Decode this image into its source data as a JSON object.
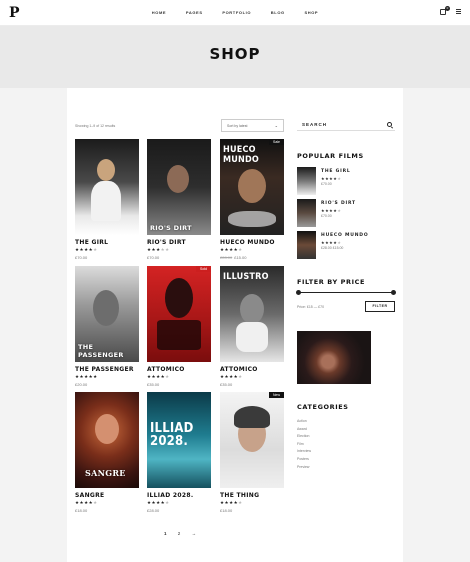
{
  "header": {
    "logo": "P",
    "nav": [
      "HOME",
      "PAGES",
      "PORTFOLIO",
      "BLOG",
      "SHOP"
    ],
    "cart_count": "0"
  },
  "hero": {
    "title": "SHOP"
  },
  "shop": {
    "result_count": "Showing 1–9 of 12 results",
    "sort_label": "Sort by latest",
    "products": [
      {
        "name": "THE GIRL",
        "poster_text": "",
        "poster_top": "",
        "rating": 4,
        "price": "£70.00",
        "old_price": "",
        "tag": ""
      },
      {
        "name": "RIO'S DIRT",
        "poster_text": "RIO'S DIRT",
        "poster_top": "",
        "rating": 4,
        "price": "£70.00",
        "old_price": "",
        "tag": ""
      },
      {
        "name": "HUECO MUNDO",
        "poster_text": "",
        "poster_top": "HUECO MUNDO",
        "rating": 4,
        "price": "£15.00",
        "old_price": "£28.00",
        "tag": "Sale"
      },
      {
        "name": "THE PASSENGER",
        "poster_text": "THE PASSENGER",
        "poster_top": "",
        "rating": 5,
        "price": "£20.00",
        "old_price": "",
        "tag": ""
      },
      {
        "name": "ATTOMICO",
        "poster_text": "",
        "poster_top": "",
        "rating": 4,
        "price": "£35.00",
        "old_price": "",
        "tag": "Sold"
      },
      {
        "name": "ATTOMICO",
        "poster_text": "",
        "poster_top": "ILLUSTRO",
        "rating": 4,
        "price": "£35.00",
        "old_price": "",
        "tag": ""
      },
      {
        "name": "SANGRE",
        "poster_text": "SANGRE",
        "poster_top": "",
        "rating": 4,
        "price": "£18.00",
        "old_price": "",
        "tag": ""
      },
      {
        "name": "ILLIAD 2028.",
        "poster_text": "",
        "poster_top": "ILLIAD 2028.",
        "rating": 4,
        "price": "£28.00",
        "old_price": "",
        "tag": ""
      },
      {
        "name": "THE THING",
        "poster_text": "",
        "poster_top": "",
        "rating": 4,
        "price": "£18.00",
        "old_price": "",
        "tag": "New"
      }
    ],
    "pagination": [
      "1",
      "2",
      "→"
    ]
  },
  "sidebar": {
    "search_placeholder": "SEARCH",
    "popular_title": "POPULAR FILMS",
    "popular": [
      {
        "name": "THE GIRL",
        "rating": 4,
        "price": "£70.00"
      },
      {
        "name": "RIO'S DIRT",
        "rating": 4,
        "price": "£70.00"
      },
      {
        "name": "HUECO MUNDO",
        "rating": 4,
        "price": "£28.00 £15.00"
      }
    ],
    "filter_title": "FILTER BY PRICE",
    "price_range": "Price: £15 — £70",
    "filter_button": "FILTER",
    "categories_title": "CATEGORIES",
    "categories": [
      "Action",
      "Award",
      "Election",
      "Film",
      "Interview",
      "Posters",
      "Preview"
    ]
  },
  "colors": {
    "accent": "#111111",
    "sale_tag": "#111111",
    "sold_tag": "#cc1f1f"
  }
}
